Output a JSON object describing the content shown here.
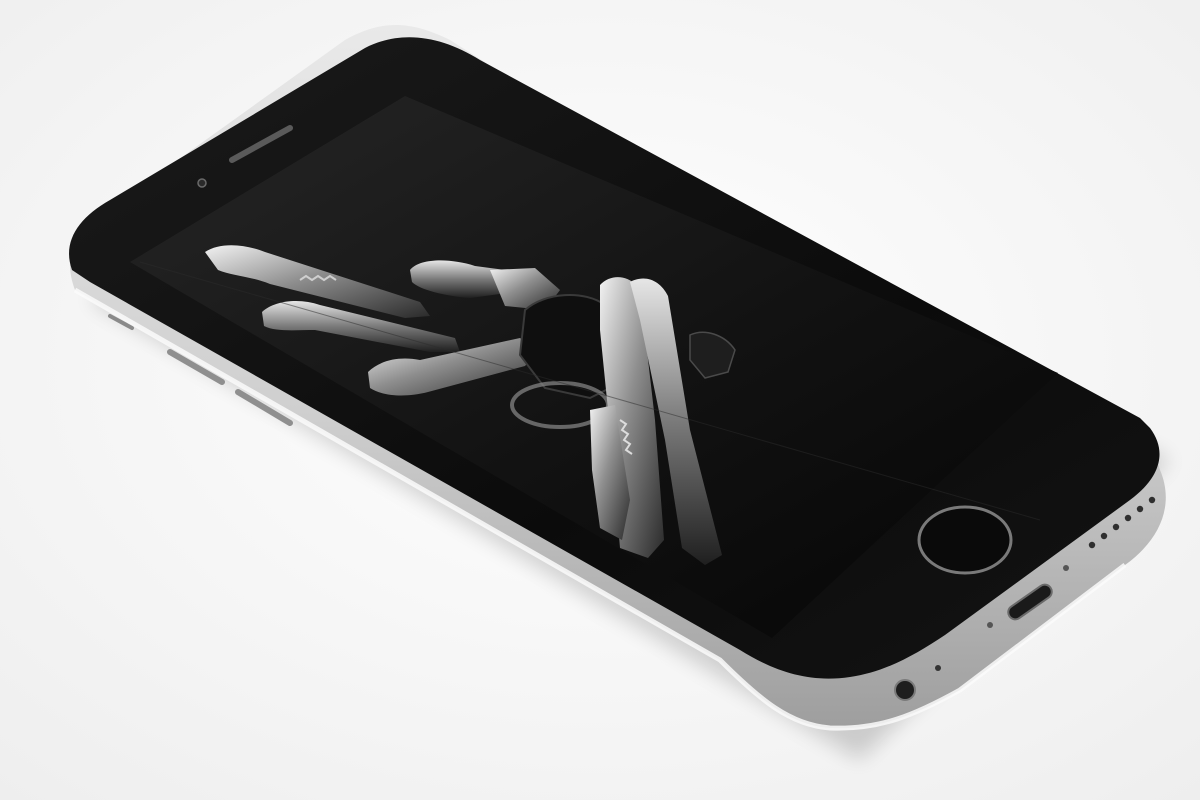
{
  "photo": {
    "subject": "smartphone-with-keys-wallpaper"
  },
  "colors": {
    "background": "#fbfbfb",
    "phone_body_silver": "#d8d8d8",
    "phone_edge_highlight": "#f4f4f4",
    "phone_front_black": "#0c0c0c",
    "screen_black": "#151515",
    "key_silver": "#cfcfcf"
  },
  "icons": {
    "earpiece": "earpiece-speaker-icon",
    "camera": "front-camera-icon",
    "home": "home-button-icon",
    "port": "lightning-port-icon",
    "jack": "headphone-jack-icon"
  }
}
